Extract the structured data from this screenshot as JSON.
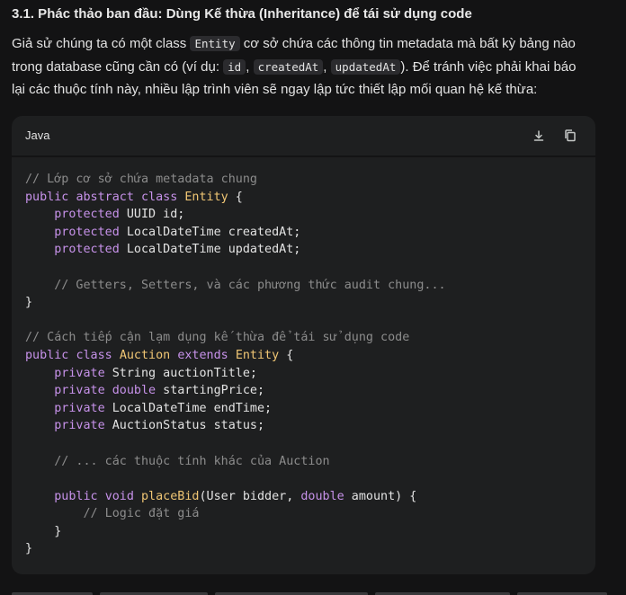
{
  "heading": "3.1. Phác thảo ban đầu: Dùng Kế thừa (Inheritance) để tái sử dụng code",
  "paragraph": {
    "l1_a": "Giả sử chúng ta có một class ",
    "l1_code": "Entity",
    "l1_b": " cơ sở chứa các thông tin metadata mà bất kỳ bảng nào",
    "l2_a": "trong database cũng cần có (ví dụ: ",
    "l2_code1": "id",
    "l2_sep1": ", ",
    "l2_code2": "createdAt",
    "l2_sep2": ", ",
    "l2_code3": "updatedAt",
    "l2_b": "). Để tránh việc phải khai báo",
    "l3": "lại các thuộc tính này, nhiều lập trình viên sẽ ngay lập tức thiết lập mối quan hệ kế thừa:"
  },
  "code_block": {
    "language": "Java",
    "download_icon": "download-icon",
    "copy_icon": "copy-icon",
    "tokens": {
      "c1": "// Lớp cơ sở chứa metadata chung",
      "public": "public",
      "abstract": "abstract",
      "class": "class",
      "Entity": "Entity",
      "open_brace": " {",
      "protected": "protected",
      "f1": " UUID id;",
      "f2": " LocalDateTime createdAt;",
      "f3": " LocalDateTime updatedAt;",
      "c2": "// Getters, Setters, và các phương thức audit chung...",
      "close_brace": "}",
      "c3": "// Cách tiếp cận lạm dụng kế thừa để tái sử dụng code",
      "Auction": "Auction",
      "extends": "extends",
      "private": "private",
      "p1": " String auctionTitle;",
      "double": "double",
      "p2": " startingPrice;",
      "p3": " LocalDateTime endTime;",
      "p4": " AuctionStatus status;",
      "c4": "// ... các thuộc tính khác của Auction",
      "void": "void",
      "placeBid": "placeBid",
      "args_a": "(User bidder, ",
      "args_b": " amount) {",
      "c5": "// Logic đặt giá"
    }
  }
}
